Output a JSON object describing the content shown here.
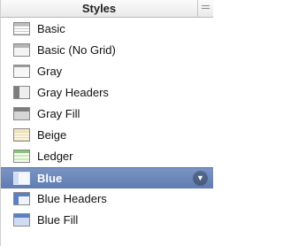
{
  "panel": {
    "title": "Styles"
  },
  "styles": [
    {
      "label": "Basic",
      "icon": "basic-table-icon",
      "selected": false
    },
    {
      "label": "Basic (No Grid)",
      "icon": "basic-no-grid-table-icon",
      "selected": false
    },
    {
      "label": "Gray",
      "icon": "gray-table-icon",
      "selected": false
    },
    {
      "label": "Gray Headers",
      "icon": "gray-headers-table-icon",
      "selected": false
    },
    {
      "label": "Gray Fill",
      "icon": "gray-fill-table-icon",
      "selected": false
    },
    {
      "label": "Beige",
      "icon": "beige-table-icon",
      "selected": false
    },
    {
      "label": "Ledger",
      "icon": "ledger-table-icon",
      "selected": false
    },
    {
      "label": "Blue",
      "icon": "blue-table-icon",
      "selected": true
    },
    {
      "label": "Blue Headers",
      "icon": "blue-headers-table-icon",
      "selected": false
    },
    {
      "label": "Blue Fill",
      "icon": "blue-fill-table-icon",
      "selected": false
    }
  ],
  "colors": {
    "selection": "#6a86ba",
    "blue_header": "#5b7fc7",
    "blue_fill": "#cfdcf3",
    "gray_header": "#7d7d7d",
    "gray_fill": "#d6d6d6",
    "beige": "#f2e6c4",
    "ledger": "#cfe8c0"
  }
}
